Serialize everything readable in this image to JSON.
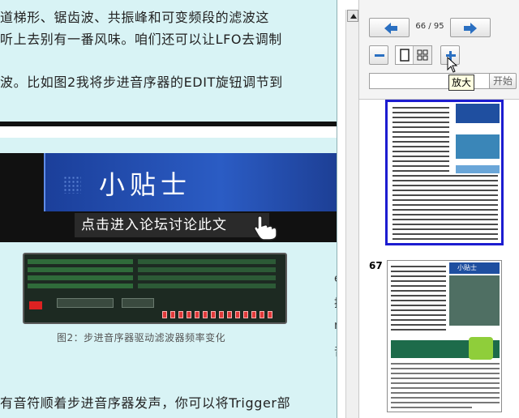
{
  "document": {
    "line1": "道梯形、锯齿波、共振峰和可变频段的滤波这",
    "line2": "听上去别有一番风味。咱们还可以让LFO去调制",
    "line3": "波。比如图2我将步进音序器的EDIT旋钮调节到",
    "banner_title": "小贴士",
    "banner_link": "点击进入论坛讨论此文",
    "caption": "图2：步进音序器驱动滤波器频率变化",
    "side_chars": [
      "e",
      "择",
      "n",
      "音"
    ],
    "line4": "有音符顺着步进音序器发声，你可以将Trigger部"
  },
  "toolbar": {
    "page_count": "66 / 95",
    "tooltip": "放大",
    "start_label": "开始",
    "search_value": ""
  },
  "thumbnails": {
    "second_label": "67",
    "second_title": "小贴士"
  },
  "icons": {
    "prev": "arrow-left-icon",
    "next": "arrow-right-icon",
    "zoom_out": "minus-icon",
    "zoom_in": "plus-icon",
    "single": "single-page-icon",
    "grid": "grid-view-icon",
    "hand": "pointing-hand-icon",
    "cursor": "mouse-pointer-icon"
  },
  "colors": {
    "page_bg": "#d8f3f5",
    "accent_blue": "#2b5cc4",
    "selection_border": "#1c1cd0",
    "tooltip_bg": "#ffffe1"
  }
}
